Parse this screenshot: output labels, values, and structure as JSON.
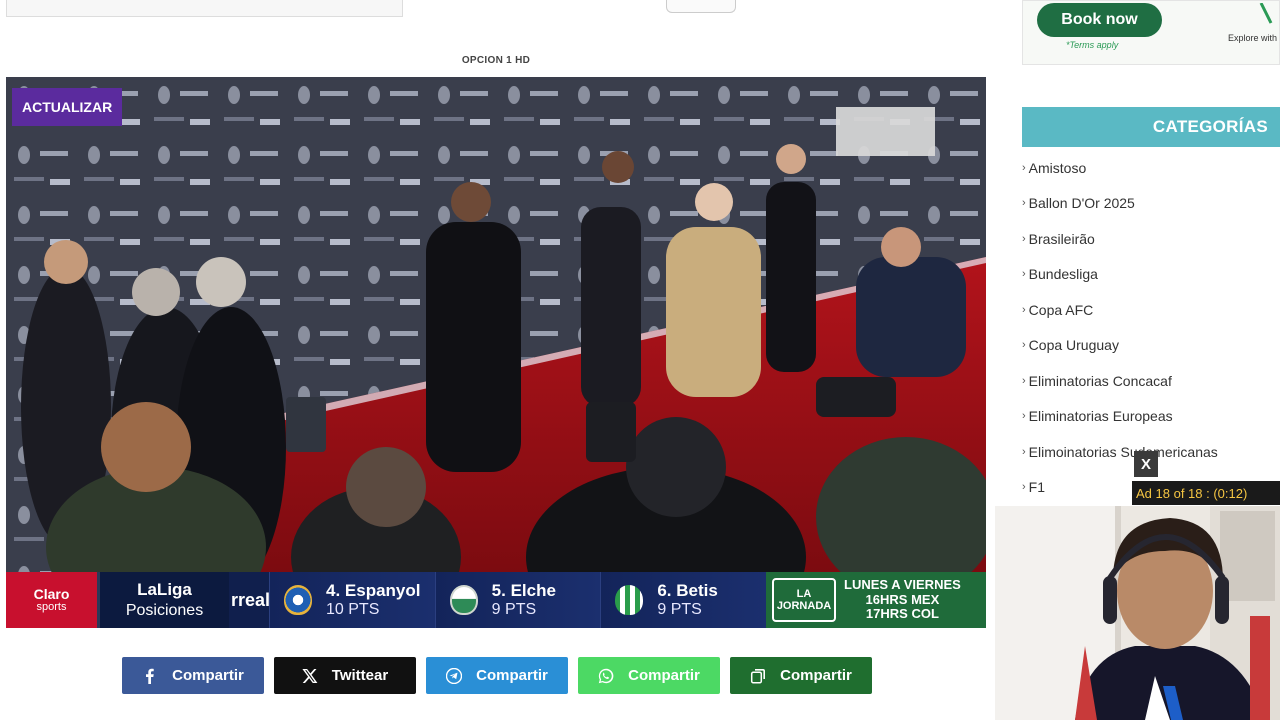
{
  "player": {
    "label": "OPCION 1 HD",
    "update_button": "ACTUALIZAR"
  },
  "ticker": {
    "logo_top": "Claro",
    "logo_bottom": "sports",
    "league": "LaLiga",
    "league_sub": "Posiciones",
    "cut_text": "rreal",
    "teams": [
      {
        "name": "4. Espanyol",
        "pts": "10 PTS",
        "color": "#1e5fb4"
      },
      {
        "name": "5. Elche",
        "pts": "9 PTS",
        "color": "#2e8b57"
      },
      {
        "name": "6. Betis",
        "pts": "9 PTS",
        "color": "#2a9d4a"
      }
    ],
    "promo_badge": "LA JORNADA",
    "promo_line1": "LUNES A VIERNES",
    "promo_line2": "16HRS MEX",
    "promo_line3": "17HRS COL"
  },
  "share": [
    {
      "label": "Compartir",
      "icon": "facebook-icon",
      "color": "#3b5998"
    },
    {
      "label": "Twittear",
      "icon": "x-icon",
      "color": "#111111"
    },
    {
      "label": "Compartir",
      "icon": "telegram-icon",
      "color": "#2a8fd6"
    },
    {
      "label": "Compartir",
      "icon": "whatsapp-icon",
      "color": "#4cd964"
    },
    {
      "label": "Compartir",
      "icon": "copy-icon",
      "color": "#1f6e2f"
    }
  ],
  "ad": {
    "button": "Book now",
    "terms": "*Terms apply",
    "explore": "Explore with"
  },
  "categories": {
    "title": "CATEGORÍAS",
    "items": [
      "Amistoso",
      "Ballon D'Or 2025",
      "Brasileirão",
      "Bundesliga",
      "Copa AFC",
      "Copa Uruguay",
      "Eliminatorias Concacaf",
      "Eliminatorias Europeas",
      "Elimoinatorias Sudamericanas",
      "F1"
    ]
  },
  "ad_overlay": {
    "close": "X",
    "counter": "Ad 18 of 18 : (0:12)"
  },
  "colors": {
    "accent_purple": "#5b2b9e",
    "category_header": "#5ab9c4",
    "ticker_bg": "#0e1d4a"
  }
}
